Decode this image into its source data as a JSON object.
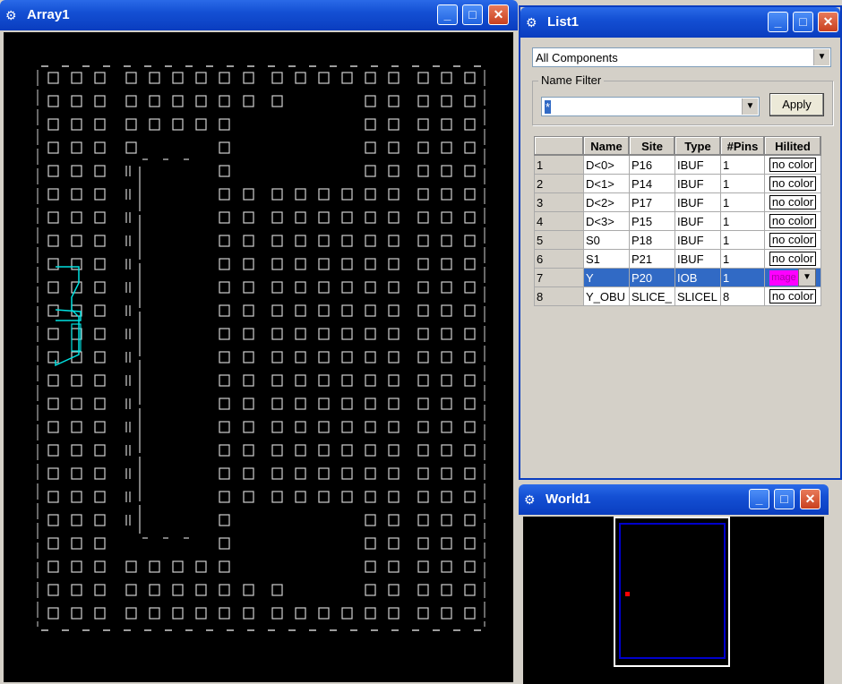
{
  "array_window": {
    "title": "Array1"
  },
  "list_window": {
    "title": "List1",
    "component_filter": "All Components",
    "name_filter_label": "Name Filter",
    "name_filter_value": "*",
    "apply_label": "Apply",
    "columns": [
      "",
      "Name",
      "Site",
      "Type",
      "#Pins",
      "Hilited"
    ],
    "rows": [
      {
        "n": "1",
        "name": "D<0>",
        "site": "P16",
        "type": "IBUF",
        "pins": "1",
        "hilited": "no color",
        "selected": false
      },
      {
        "n": "2",
        "name": "D<1>",
        "site": "P14",
        "type": "IBUF",
        "pins": "1",
        "hilited": "no color",
        "selected": false
      },
      {
        "n": "3",
        "name": "D<2>",
        "site": "P17",
        "type": "IBUF",
        "pins": "1",
        "hilited": "no color",
        "selected": false
      },
      {
        "n": "4",
        "name": "D<3>",
        "site": "P15",
        "type": "IBUF",
        "pins": "1",
        "hilited": "no color",
        "selected": false
      },
      {
        "n": "5",
        "name": "S0",
        "site": "P18",
        "type": "IBUF",
        "pins": "1",
        "hilited": "no color",
        "selected": false
      },
      {
        "n": "6",
        "name": "S1",
        "site": "P21",
        "type": "IBUF",
        "pins": "1",
        "hilited": "no color",
        "selected": false
      },
      {
        "n": "7",
        "name": "Y",
        "site": "P20",
        "type": "IOB",
        "pins": "1",
        "hilited": "mage",
        "selected": true
      },
      {
        "n": "8",
        "name": "Y_OBU",
        "site": "SLICE_",
        "type": "SLICEL",
        "pins": "8",
        "hilited": "no color",
        "selected": false
      }
    ]
  },
  "world_window": {
    "title": "World1"
  },
  "icons": {
    "app": "chip-icon",
    "minimize": "minimize-icon",
    "maximize": "maximize-icon",
    "close": "close-icon"
  },
  "colors": {
    "titlebar": "#0a3dbf",
    "grid_lines": "#d0d0d0",
    "route": "#00e0e0",
    "highlight": "#ff00ff",
    "world_frame": "#0000cc",
    "world_marker": "#ff0000"
  }
}
